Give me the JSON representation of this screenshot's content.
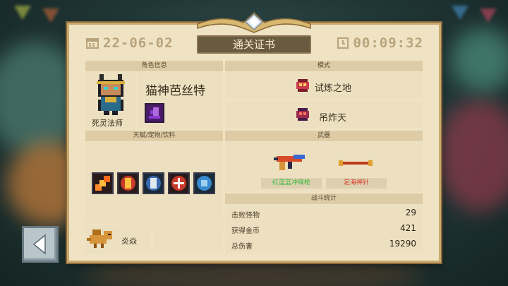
{
  "header": {
    "date": "22-06-02",
    "title": "通关证书",
    "timer": "00:09:32"
  },
  "character": {
    "section_label": "角色信息",
    "name": "猫神芭丝特",
    "class": "死灵法师"
  },
  "mode": {
    "section_label": "模式",
    "items": [
      "试炼之地",
      "吊炸天"
    ]
  },
  "talents": {
    "section_label": "天赋/宠物/饮料",
    "pet_name": "炎焱"
  },
  "weapons": {
    "section_label": "武器",
    "items": [
      {
        "name": "红蓝蓝冲锋枪",
        "color": "#3eb83e"
      },
      {
        "name": "定海神针",
        "color": "#d83a2a"
      }
    ]
  },
  "stats": {
    "section_label": "战斗统计",
    "rows": [
      {
        "label": "击败怪物",
        "value": "29"
      },
      {
        "label": "获得金币",
        "value": "421"
      },
      {
        "label": "总伤害",
        "value": "19290"
      }
    ]
  },
  "colors": {
    "card_bg": "#efe3c3",
    "banner": "#6a5a40",
    "accent_gold": "#c9a96e"
  }
}
